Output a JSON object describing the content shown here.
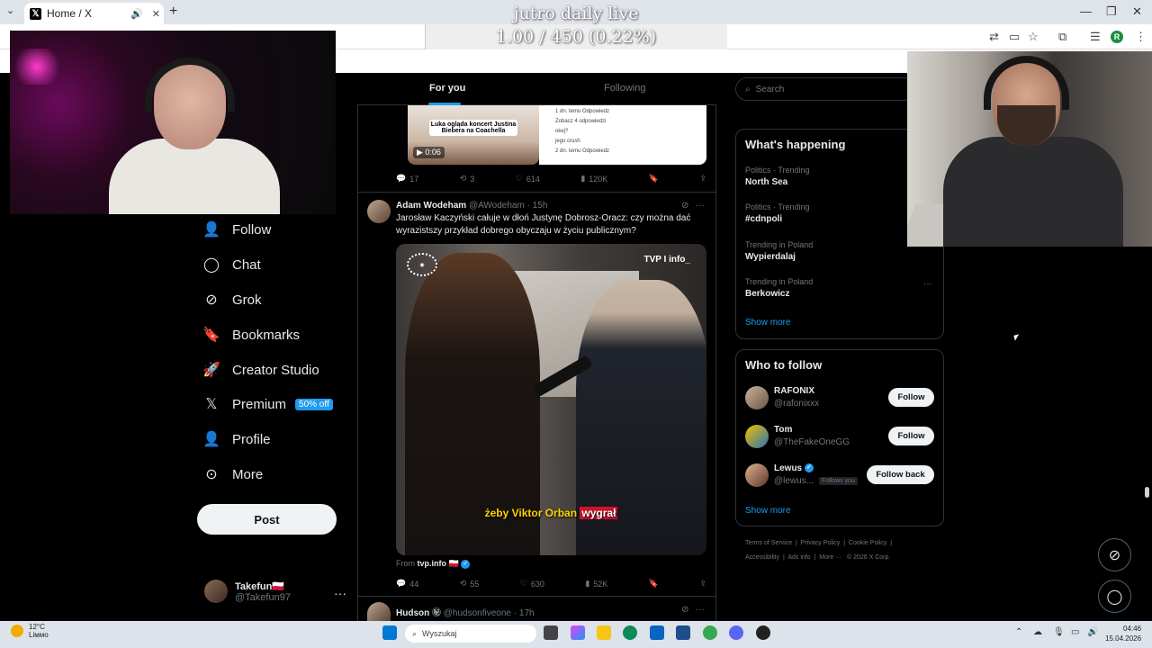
{
  "browser": {
    "tab_title": "Home / X",
    "new_tab": "+",
    "profile_initial": "R"
  },
  "overlay": {
    "title": "jutro daily live",
    "goal": "1.00 / 450 (0.22%)"
  },
  "feed": {
    "tab_for_you": "For you",
    "tab_following": "Following"
  },
  "tweet1": {
    "media_caption": "Luka ogląda koncert Justina Biebera na Coachella",
    "duration": "0:06",
    "side_lines": [
      "1 dn. temu  Odpowiedz",
      "Zobacz 4 odpowiedzi",
      "okej?",
      "jego crush",
      "2 dn. temu  Odpowiedz"
    ],
    "replies": "17",
    "reposts": "3",
    "likes": "614",
    "views": "120K"
  },
  "tweet2": {
    "author": "Adam Wodeham",
    "handle": "@AWodeham",
    "time": "· 15h",
    "text": "Jarosław Kaczyński całuje w dłoń Justynę Dobrosz-Oracz: czy można dać wyrazistszy przykład dobrego obyczaju w życiu publicznym?",
    "video_tag": "TVP I info_",
    "subtitle_before": "żeby Viktor Orban ",
    "subtitle_highlight": "wygrał",
    "from_label": "From",
    "from_source": "tvp.info",
    "replies": "44",
    "reposts": "55",
    "likes": "630",
    "views": "52K"
  },
  "tweet3": {
    "author": "Hudson",
    "handle": "@hudsonfiveone",
    "time": "· 17h"
  },
  "nav": {
    "follow": "Follow",
    "chat": "Chat",
    "grok": "Grok",
    "bookmarks": "Bookmarks",
    "creator_studio": "Creator Studio",
    "premium": "Premium",
    "premium_badge": "50% off",
    "profile": "Profile",
    "more": "More",
    "post": "Post"
  },
  "me": {
    "name": "Takefun🇵🇱",
    "handle": "@Takefun97"
  },
  "search": {
    "placeholder": "Search"
  },
  "happening": {
    "title": "What's happening",
    "trends": [
      {
        "category": "Politics · Trending",
        "name": "North Sea"
      },
      {
        "category": "Politics · Trending",
        "name": "#cdnpoli"
      },
      {
        "category": "Trending in Poland",
        "name": "Wypierdalaj"
      },
      {
        "category": "Trending in Poland",
        "name": "Berkowicz"
      }
    ],
    "show_more": "Show more"
  },
  "who_to_follow": {
    "title": "Who to follow",
    "users": [
      {
        "name": "RAFONIX",
        "handle": "@rafonixxx",
        "button": "Follow"
      },
      {
        "name": "Tom",
        "handle": "@TheFakeOneGG",
        "button": "Follow"
      },
      {
        "name": "Lewus",
        "handle": "@lewus...",
        "button": "Follow back",
        "follows_you": "Follows you"
      }
    ],
    "show_more": "Show more"
  },
  "footer": {
    "line1": [
      "Terms of Service",
      "Privacy Policy",
      "Cookie Policy"
    ],
    "line2": [
      "Accessibility",
      "Ads info",
      "More ···",
      "© 2026 X Corp."
    ]
  },
  "taskbar": {
    "temp": "12°C",
    "weather": "Liммо",
    "search_placeholder": "Wyszukaj",
    "time": "04:46",
    "date": "15.04.2026"
  }
}
